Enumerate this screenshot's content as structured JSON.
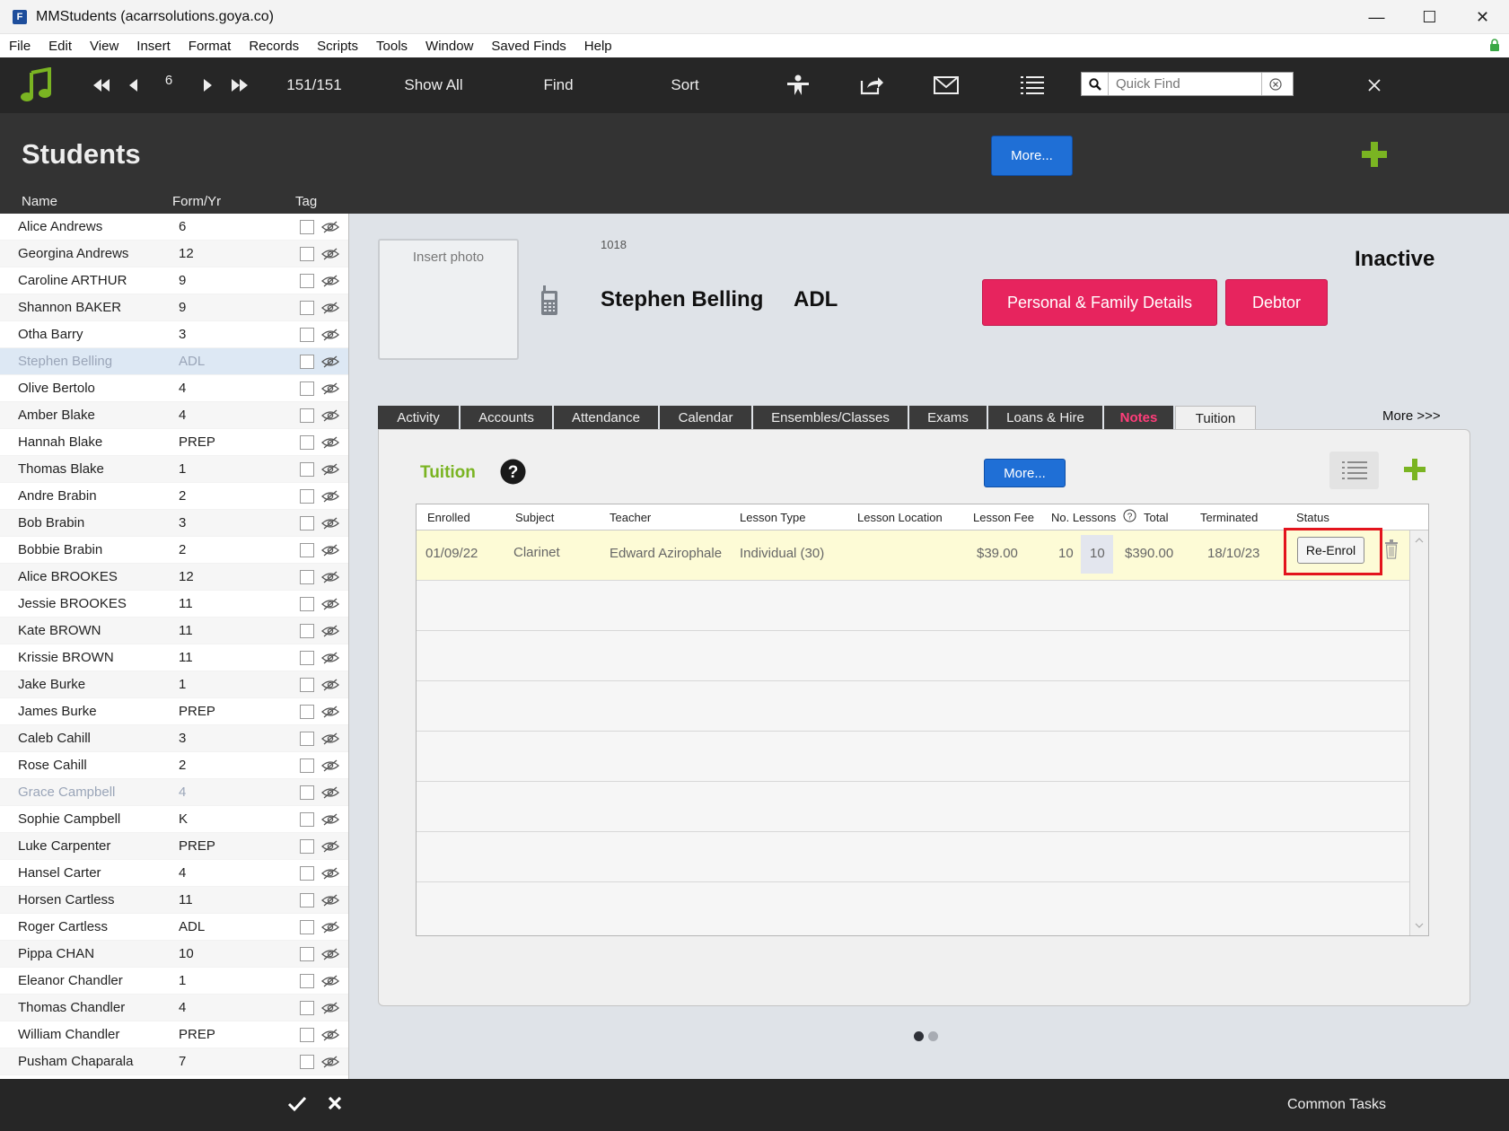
{
  "window": {
    "title": "MMStudents (acarrsolutions.goya.co)"
  },
  "menu": [
    "File",
    "Edit",
    "View",
    "Insert",
    "Format",
    "Records",
    "Scripts",
    "Tools",
    "Window",
    "Saved Finds",
    "Help"
  ],
  "toolbar": {
    "record_number": "6",
    "record_count": "151/151",
    "show_all": "Show All",
    "find": "Find",
    "sort": "Sort",
    "quick_find_placeholder": "Quick Find"
  },
  "header": {
    "title": "Students",
    "more_label": "More...",
    "columns": {
      "name": "Name",
      "form_yr": "Form/Yr",
      "tag": "Tag"
    }
  },
  "students": [
    {
      "name": "Alice Andrews",
      "form": "6"
    },
    {
      "name": "Georgina Andrews",
      "form": "12"
    },
    {
      "name": "Caroline ARTHUR",
      "form": "9"
    },
    {
      "name": "Shannon BAKER",
      "form": "9"
    },
    {
      "name": "Otha Barry",
      "form": "3"
    },
    {
      "name": "Stephen Belling",
      "form": "ADL",
      "selected": true
    },
    {
      "name": "Olive Bertolo",
      "form": "4"
    },
    {
      "name": "Amber Blake",
      "form": "4"
    },
    {
      "name": "Hannah Blake",
      "form": "PREP"
    },
    {
      "name": "Thomas Blake",
      "form": "1"
    },
    {
      "name": "Andre Brabin",
      "form": "2"
    },
    {
      "name": "Bob Brabin",
      "form": "3"
    },
    {
      "name": "Bobbie Brabin",
      "form": "2"
    },
    {
      "name": "Alice BROOKES",
      "form": "12"
    },
    {
      "name": "Jessie BROOKES",
      "form": "11"
    },
    {
      "name": "Kate BROWN",
      "form": "11"
    },
    {
      "name": "Krissie BROWN",
      "form": "11"
    },
    {
      "name": "Jake Burke",
      "form": "1"
    },
    {
      "name": "James Burke",
      "form": "PREP"
    },
    {
      "name": "Caleb Cahill",
      "form": "3"
    },
    {
      "name": "Rose Cahill",
      "form": "2"
    },
    {
      "name": "Grace Campbell",
      "form": "4",
      "inactive": true
    },
    {
      "name": "Sophie Campbell",
      "form": "K"
    },
    {
      "name": "Luke Carpenter",
      "form": "PREP"
    },
    {
      "name": "Hansel Carter",
      "form": "4"
    },
    {
      "name": "Horsen Cartless",
      "form": "11"
    },
    {
      "name": "Roger Cartless",
      "form": "ADL"
    },
    {
      "name": "Pippa CHAN",
      "form": "10"
    },
    {
      "name": "Eleanor Chandler",
      "form": "1"
    },
    {
      "name": "Thomas Chandler",
      "form": "4"
    },
    {
      "name": "William Chandler",
      "form": "PREP"
    },
    {
      "name": "Pusham Chaparala",
      "form": "7"
    }
  ],
  "detail": {
    "insert_photo": "Insert photo",
    "student_id": "1018",
    "student_name": "Stephen Belling",
    "student_form": "ADL",
    "status": "Inactive",
    "personal_btn": "Personal & Family Details",
    "debtor_btn": "Debtor"
  },
  "tabs": [
    {
      "label": "Activity",
      "w": 92
    },
    {
      "label": "Accounts",
      "w": 104
    },
    {
      "label": "Attendance",
      "w": 118
    },
    {
      "label": "Calendar",
      "w": 104
    },
    {
      "label": "Ensembles/Classes",
      "w": 174
    },
    {
      "label": "Exams",
      "w": 88
    },
    {
      "label": "Loans & Hire",
      "w": 129
    },
    {
      "label": "Notes",
      "w": 79,
      "notes": true
    },
    {
      "label": "Tuition",
      "w": 90,
      "active": true
    }
  ],
  "more_tabs": "More >>>",
  "tuition": {
    "title": "Tuition",
    "more_label": "More...",
    "columns": {
      "enrolled": "Enrolled",
      "subject": "Subject",
      "teacher": "Teacher",
      "lesson_type": "Lesson Type",
      "lesson_location": "Lesson Location",
      "lesson_fee": "Lesson Fee",
      "no_lessons": "No. Lessons",
      "total": "Total",
      "terminated": "Terminated",
      "status": "Status"
    },
    "rows": [
      {
        "enrolled": "01/09/22",
        "subject": "Clarinet",
        "teacher": "Edward Azirophale",
        "lesson_type": "Individual (30)",
        "lesson_location": "",
        "lesson_fee": "$39.00",
        "no_lessons": "10",
        "no_lessons_attended": "10",
        "total": "$390.00",
        "terminated": "18/10/23",
        "action": "Re-Enrol"
      }
    ]
  },
  "footer": {
    "common_tasks": "Common Tasks"
  },
  "colors": {
    "accent_green": "#7ab422",
    "pink": "#e7245e",
    "blue": "#1f6fd6",
    "highlight_red": "#e3141d"
  }
}
